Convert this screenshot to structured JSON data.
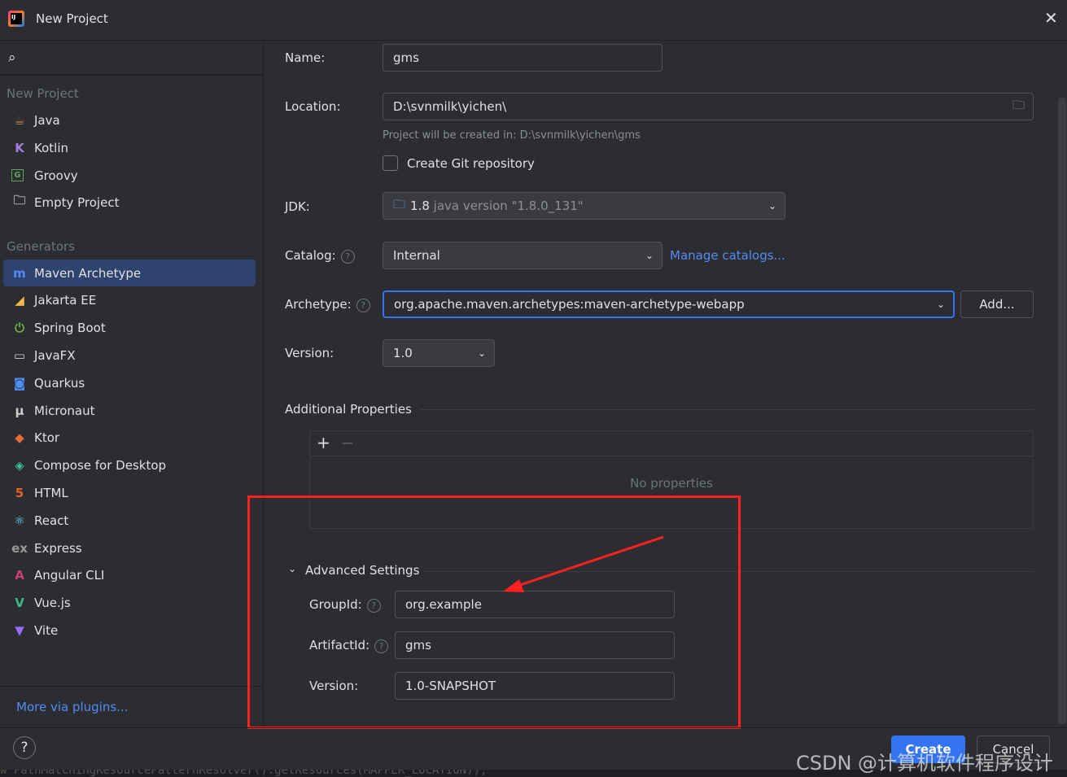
{
  "window": {
    "title": "New Project"
  },
  "sidebar": {
    "section_new": "New Project",
    "new_items": [
      {
        "label": "Java",
        "icon": "java-icon"
      },
      {
        "label": "Kotlin",
        "icon": "kotlin-icon"
      },
      {
        "label": "Groovy",
        "icon": "groovy-icon"
      },
      {
        "label": "Empty Project",
        "icon": "empty-project-icon"
      }
    ],
    "section_generators": "Generators",
    "generators": [
      {
        "label": "Maven Archetype"
      },
      {
        "label": "Jakarta EE"
      },
      {
        "label": "Spring Boot"
      },
      {
        "label": "JavaFX"
      },
      {
        "label": "Quarkus"
      },
      {
        "label": "Micronaut"
      },
      {
        "label": "Ktor"
      },
      {
        "label": "Compose for Desktop"
      },
      {
        "label": "HTML"
      },
      {
        "label": "React"
      },
      {
        "label": "Express"
      },
      {
        "label": "Angular CLI"
      },
      {
        "label": "Vue.js"
      },
      {
        "label": "Vite"
      }
    ],
    "selected": "Maven Archetype",
    "more_plugins": "More via plugins..."
  },
  "form": {
    "name_label": "Name:",
    "name_value": "gms",
    "location_label": "Location:",
    "location_value": "D:\\svnmilk\\yichen\\",
    "location_hint": "Project will be created in: D:\\svnmilk\\yichen\\gms",
    "git_label": "Create Git repository",
    "git_checked": false,
    "jdk_label": "JDK:",
    "jdk_value": "1.8",
    "jdk_detail": "java version \"1.8.0_131\"",
    "catalog_label": "Catalog:",
    "catalog_value": "Internal",
    "manage_catalogs": "Manage catalogs...",
    "archetype_label": "Archetype:",
    "archetype_value": "org.apache.maven.archetypes:maven-archetype-webapp",
    "add_button": "Add...",
    "version_label": "Version:",
    "version_value": "1.0",
    "additional_props": "Additional Properties",
    "add_icon": "+",
    "remove_icon": "−",
    "no_props": "No properties",
    "advanced": "Advanced Settings",
    "groupid_label": "GroupId:",
    "groupid_value": "org.example",
    "artifactid_label": "ArtifactId:",
    "artifactid_value": "gms",
    "adv_version_label": "Version:",
    "adv_version_value": "1.0-SNAPSHOT"
  },
  "footer": {
    "help": "?",
    "create": "Create",
    "cancel": "Cancel"
  },
  "watermark": "CSDN @计算机软件程序设计",
  "background_code": "w PathMatchingResourcePatternResolver().getResources(MAPPER_LOCATION));",
  "colors": {
    "accent": "#3574f0",
    "selected": "#2e436e",
    "annotation": "#ff2020"
  }
}
